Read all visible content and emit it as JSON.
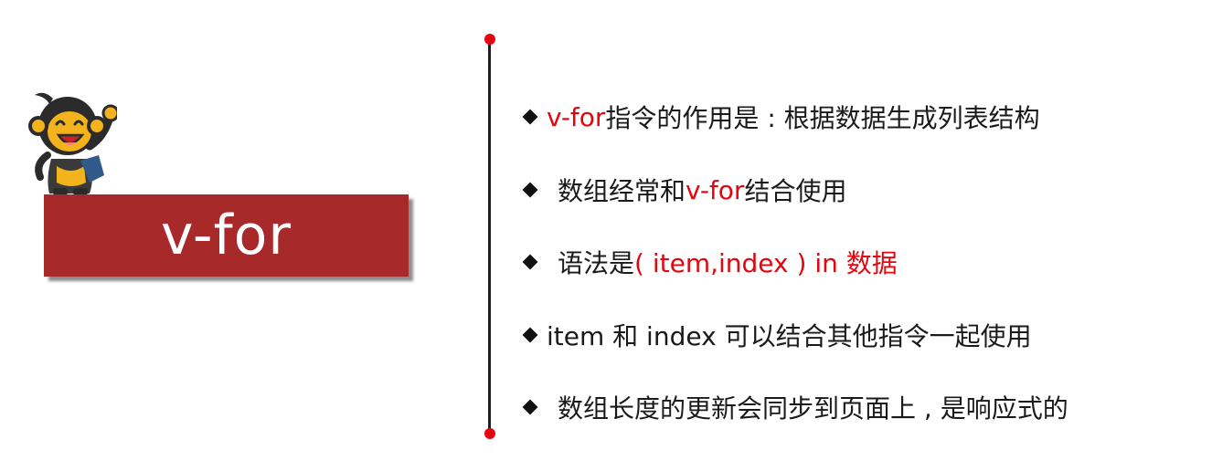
{
  "title": "v-for",
  "colors": {
    "banner": "#a8292a",
    "accent": "#e3060f",
    "text": "#1a1a1a"
  },
  "mascot": {
    "icon": "monkey-mascot-icon"
  },
  "bullets": [
    {
      "icon": "diamond-bullet-icon",
      "parts": [
        {
          "text": "v-for",
          "color": "red"
        },
        {
          "text": " 指令的作用是 : 根据数据生成列表结构",
          "color": "black"
        }
      ]
    },
    {
      "icon": "diamond-bullet-icon",
      "parts": [
        {
          "text": "数组经常和 ",
          "color": "black"
        },
        {
          "text": "v-for",
          "color": "red"
        },
        {
          "text": " 结合使用",
          "color": "black"
        }
      ]
    },
    {
      "icon": "diamond-bullet-icon",
      "parts": [
        {
          "text": "语法是 ",
          "color": "black"
        },
        {
          "text": "( item,index ) in  数据",
          "color": "red"
        }
      ]
    },
    {
      "icon": "diamond-bullet-icon",
      "parts": [
        {
          "text": "item  和  index  可以结合其他指令一起使用",
          "color": "black"
        }
      ]
    },
    {
      "icon": "diamond-bullet-icon",
      "parts": [
        {
          "text": "数组长度的更新会同步到页面上 , 是响应式的",
          "color": "black"
        }
      ]
    }
  ]
}
